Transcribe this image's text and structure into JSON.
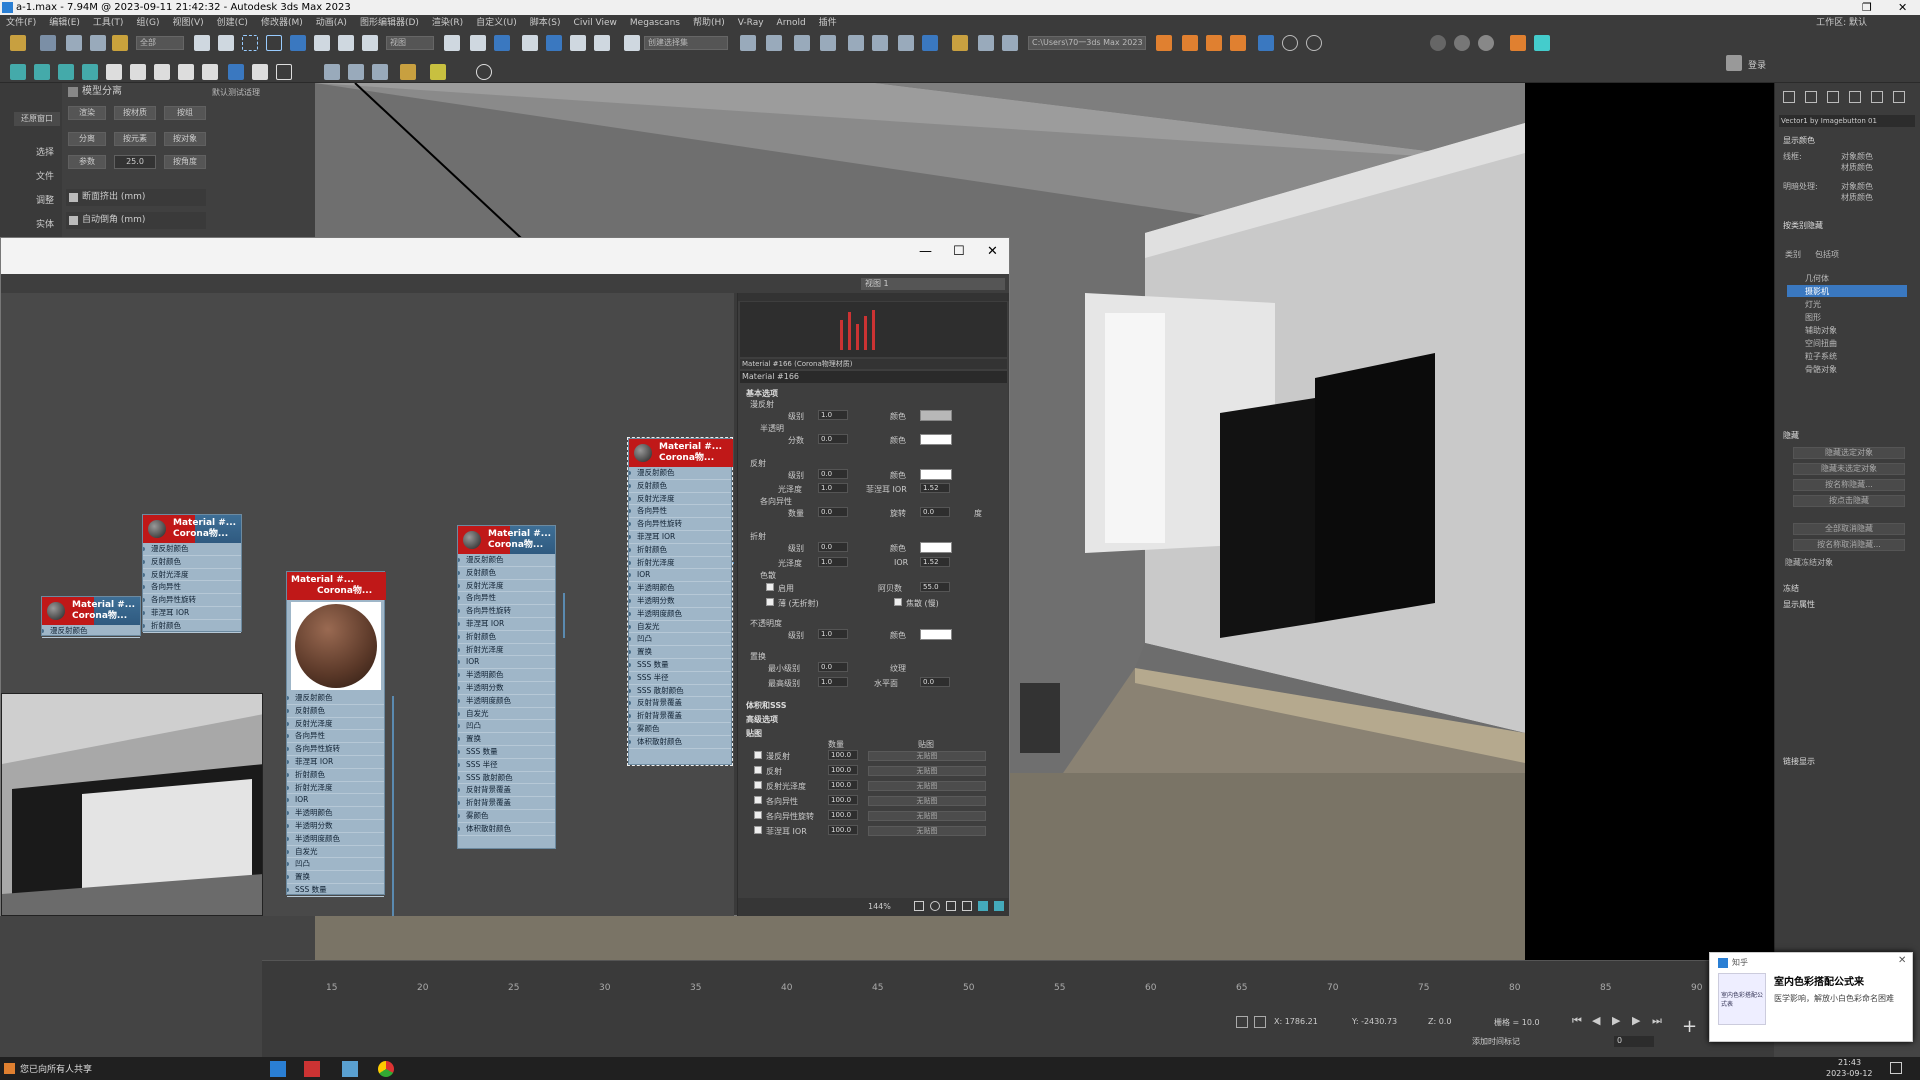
{
  "window": {
    "title": "a-1.max - 7.94M @ 2023-09-11 21:42:32 - Autodesk 3ds Max 2023"
  },
  "menu": {
    "items": [
      "文件(F)",
      "编辑(E)",
      "工具(T)",
      "组(G)",
      "视图(V)",
      "创建(C)",
      "修改器(M)",
      "动画(A)",
      "图形编辑器(D)",
      "渲染(R)",
      "自定义(U)",
      "脚本(S)",
      "Civil View",
      "Megascans",
      "帮助(H)",
      "V-Ray",
      "Arnold",
      "插件"
    ],
    "workspace": "工作区: 默认"
  },
  "toolbar": {
    "filter": "全部",
    "view": "视图",
    "selset": "创建选择集",
    "path": "C:\\Users\\70一3ds Max 2023",
    "signin": "登录"
  },
  "left_panel": {
    "title": "模型分离",
    "rows": [
      [
        "渲染",
        "按材质",
        "按组"
      ],
      [
        "分离",
        "按元素",
        "按对象"
      ],
      [
        "参数",
        "25.0",
        "按角度"
      ]
    ],
    "tabs": [
      "还原窗口",
      "选择",
      "文件",
      "调整",
      "实体"
    ],
    "opt1": "断面挤出 (mm)",
    "opt2": "自动倒角 (mm)",
    "label_default": "默认测试适理"
  },
  "sme": {
    "view_label": "视图 1",
    "zoom": "144%"
  },
  "nodes": [
    {
      "title": "Material #... Corona物...",
      "slots": [
        "漫反射颜色",
        "反射颜色",
        "反射光泽度",
        "各向异性",
        "各向异性旋转",
        "菲涅耳 IOR",
        "折射颜色"
      ]
    },
    {
      "title": "Material #... Corona物...",
      "slots": [
        "漫反射颜色",
        "反射颜色",
        "反射光泽度",
        "各向异性",
        "各向异性旋转",
        "菲涅耳 IOR",
        "折射颜色",
        "折射光泽度"
      ]
    },
    {
      "title": "Material #... Corona物...",
      "slots": [
        "漫反射颜色",
        "反射颜色",
        "反射光泽度",
        "各向异性",
        "各向异性旋转",
        "菲涅耳 IOR",
        "折射颜色",
        "折射光泽度",
        "IOR",
        "半透明颜色",
        "半透明分数",
        "半透明度颜色",
        "自发光",
        "凹凸",
        "置换",
        "SSS 数量",
        "SSS 半径",
        "SSS 散射颜色",
        "反射背景覆盖",
        "折射背景覆盖",
        "雾颜色",
        "体积散射颜色"
      ]
    },
    {
      "title": "Material #... Corona物...",
      "slots": [
        "漫反射颜色",
        "反射颜色",
        "反射光泽度",
        "各向异性",
        "各向异性旋转",
        "菲涅耳 IOR",
        "折射颜色",
        "折射光泽度",
        "IOR",
        "半透明颜色",
        "半透明分数",
        "半透明度颜色",
        "自发光",
        "凹凸",
        "置换",
        "SSS 数量",
        "SSS 半径",
        "SSS 散射颜色",
        "反射背景覆盖",
        "折射背景覆盖",
        "雾颜色",
        "体积散射颜色"
      ]
    },
    {
      "title": "Material #... Corona物...",
      "slots": [
        "漫反射颜色",
        "反射颜色",
        "反射光泽度",
        "各向异性",
        "各向异性旋转",
        "菲涅耳 IOR",
        "折射颜色",
        "折射光泽度",
        "IOR",
        "半透明颜色",
        "半透明分数",
        "半透明度颜色",
        "自发光",
        "凹凸",
        "置换",
        "SSS 数量",
        "SSS 半径",
        "SSS 散射颜色",
        "反射背景覆盖",
        "折射背景覆盖",
        "雾颜色",
        "体积散射颜色"
      ]
    },
    {
      "title": "Material #... Corona物...",
      "slots": [
        "漫反射颜色"
      ]
    }
  ],
  "props": {
    "header": "Material #166 (Corona物理材质)",
    "name": "Material #166",
    "section_basic": "基本选项",
    "diffuse": "漫反射",
    "level": "级别",
    "color": "颜色",
    "translucency": "半透明",
    "fraction": "分数",
    "reflect": "反射",
    "gloss": "光泽度",
    "fresnel": "菲涅耳 IOR",
    "anisotropy": "各向异性",
    "amount": "数量",
    "rotation": "旋转",
    "deg": "度",
    "refract": "折射",
    "ior": "IOR",
    "color_label": "色散",
    "enable": "启用",
    "abbe": "阿贝数",
    "thin": "薄 (无折射)",
    "caustics": "焦散 (慢)",
    "opacity": "不透明度",
    "displace": "置换",
    "min_level": "最小级别",
    "max_level": "最高级别",
    "texture": "纹理",
    "water": "水平面",
    "val_1": "1.0",
    "val_0": "0.0",
    "val_152": "1.52",
    "val_553": "55.0",
    "section_vol": "体积和SSS",
    "section_adv": "高级选项",
    "section_maps": "贴图",
    "maps_amount": "数量",
    "maps_map": "贴图",
    "none": "无贴图",
    "val_100": "100.0",
    "maps": [
      "漫反射",
      "反射",
      "反射光泽度",
      "各向异性",
      "各向异性旋转",
      "菲涅耳 IOR"
    ]
  },
  "right_panel": {
    "obj": "Vector1 by Imagebutton 01",
    "display_color": "显示颜色",
    "wire": "线框:",
    "shaded": "明暗处理:",
    "obj_color": "对象颜色",
    "mat_color": "材质颜色",
    "by_cat": "按类别隐藏",
    "filters": [
      "几何体",
      "摄影机",
      "灯光",
      "图形",
      "辅助对象",
      "空间扭曲",
      "粒子系统",
      "骨骼对象"
    ],
    "hide": "隐藏",
    "hide_btns": [
      "隐藏选定对象",
      "隐藏未选定对象",
      "按名称隐藏...",
      "按点击隐藏",
      "全部取消隐藏",
      "按名称取消隐藏...",
      "隐藏冻结对象"
    ],
    "freeze": "冻结",
    "display_props": "显示属性",
    "link_display": "链接显示",
    "tabs": [
      "类别",
      "包括项"
    ]
  },
  "timeline": {
    "ticks": [
      "15",
      "20",
      "25",
      "30",
      "35",
      "40",
      "45",
      "50",
      "55",
      "60",
      "65",
      "70",
      "75",
      "80",
      "85",
      "90"
    ]
  },
  "status": {
    "x": "X: 1786.21",
    "y": "Y: -2430.73",
    "z": "Z: 0.0",
    "grid": "栅格 = 10.0",
    "add_time": "添加时间标记",
    "frame": "0"
  },
  "taskbar": {
    "share": "您已向所有人共享",
    "time": "21:43",
    "date": "2023-09-12"
  },
  "notification": {
    "app": "知乎",
    "title": "室内色彩搭配公式来",
    "body": "医学影响，解放小白色彩命名困难",
    "thumb": "室内色彩搭配公式表"
  }
}
